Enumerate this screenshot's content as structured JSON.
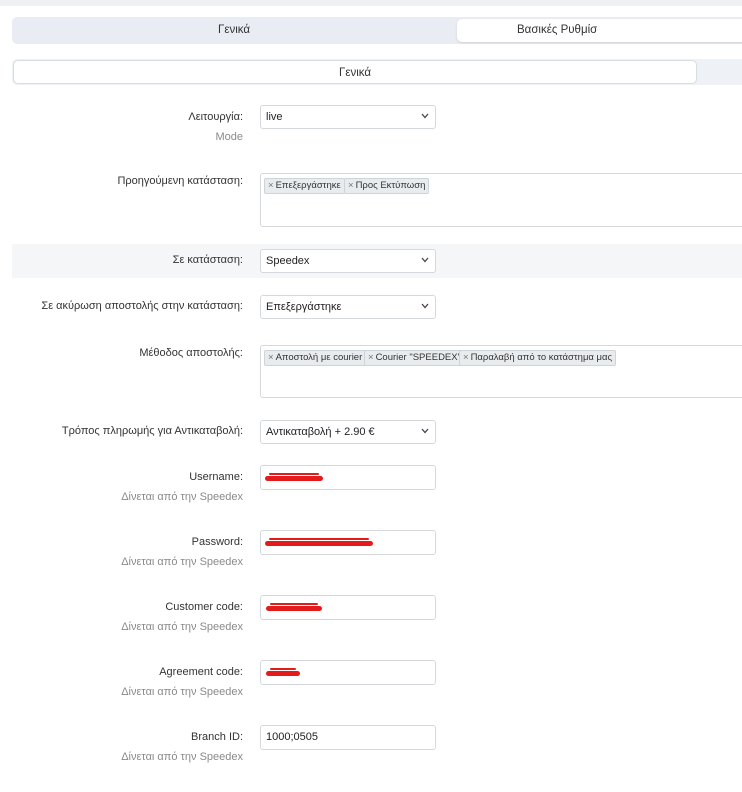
{
  "tabs": [
    "Γενικά",
    "Βασικές Ρυθμίσ"
  ],
  "subtabs": [
    "Γενικά"
  ],
  "fields": {
    "mode": {
      "label": "Λειτουργία:",
      "help": "Mode",
      "value": "live"
    },
    "previous_status": {
      "label": "Προηγούμενη κατάσταση:",
      "tags": [
        "Επεξεργάστηκε",
        "Προς Εκτύπωση"
      ]
    },
    "to_status": {
      "label": "Σε κατάσταση:",
      "value": "Speedex"
    },
    "cancel_status": {
      "label": "Σε ακύρωση αποστολής στην κατάσταση:",
      "value": "Επεξεργάστηκε"
    },
    "shipping_method": {
      "label": "Μέθοδος αποστολής:",
      "tags": [
        "Αποστολή με courier",
        "Courier \"SPEEDEX\"",
        "Παραλαβή από το κατάστημα μας"
      ]
    },
    "cod_payment": {
      "label": "Τρόπος πληρωμής για Αντικαταβολή:",
      "value": "Αντικαταβολή + 2.90 €"
    },
    "username": {
      "label": "Username:",
      "help": "Δίνεται από την Speedex"
    },
    "password": {
      "label": "Password:",
      "help": "Δίνεται από την Speedex"
    },
    "customer_code": {
      "label": "Customer code:",
      "help": "Δίνεται από την Speedex"
    },
    "agreement_code": {
      "label": "Agreement code:",
      "help": "Δίνεται από την Speedex"
    },
    "branch_id": {
      "label": "Branch ID:",
      "help": "Δίνεται από την Speedex",
      "value": "1000;0505"
    }
  },
  "icons": {
    "select_arrow": "chevron-down-icon",
    "tag_remove": "close-icon",
    "redaction": "red-scribble"
  },
  "colors": {
    "redaction": "#e41b1b",
    "tabbar": "#e9edf3",
    "highlight_row": "#f4f6f8"
  }
}
